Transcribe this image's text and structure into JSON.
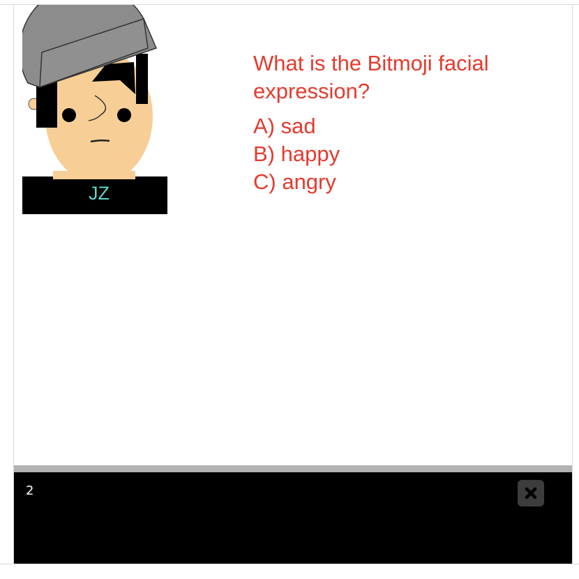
{
  "avatar": {
    "initials": "JZ",
    "initials_color": "#5ad8c8",
    "skin_color": "#f7cf96",
    "hat_color": "#8c8c8c",
    "hair_color": "#000000"
  },
  "question": {
    "text": "What is the Bitmoji facial expression?",
    "color": "#e53a2d",
    "options": [
      "A) sad",
      "B) happy",
      "C) angry"
    ]
  },
  "console": {
    "output": "2",
    "close_icon": "close-icon"
  }
}
